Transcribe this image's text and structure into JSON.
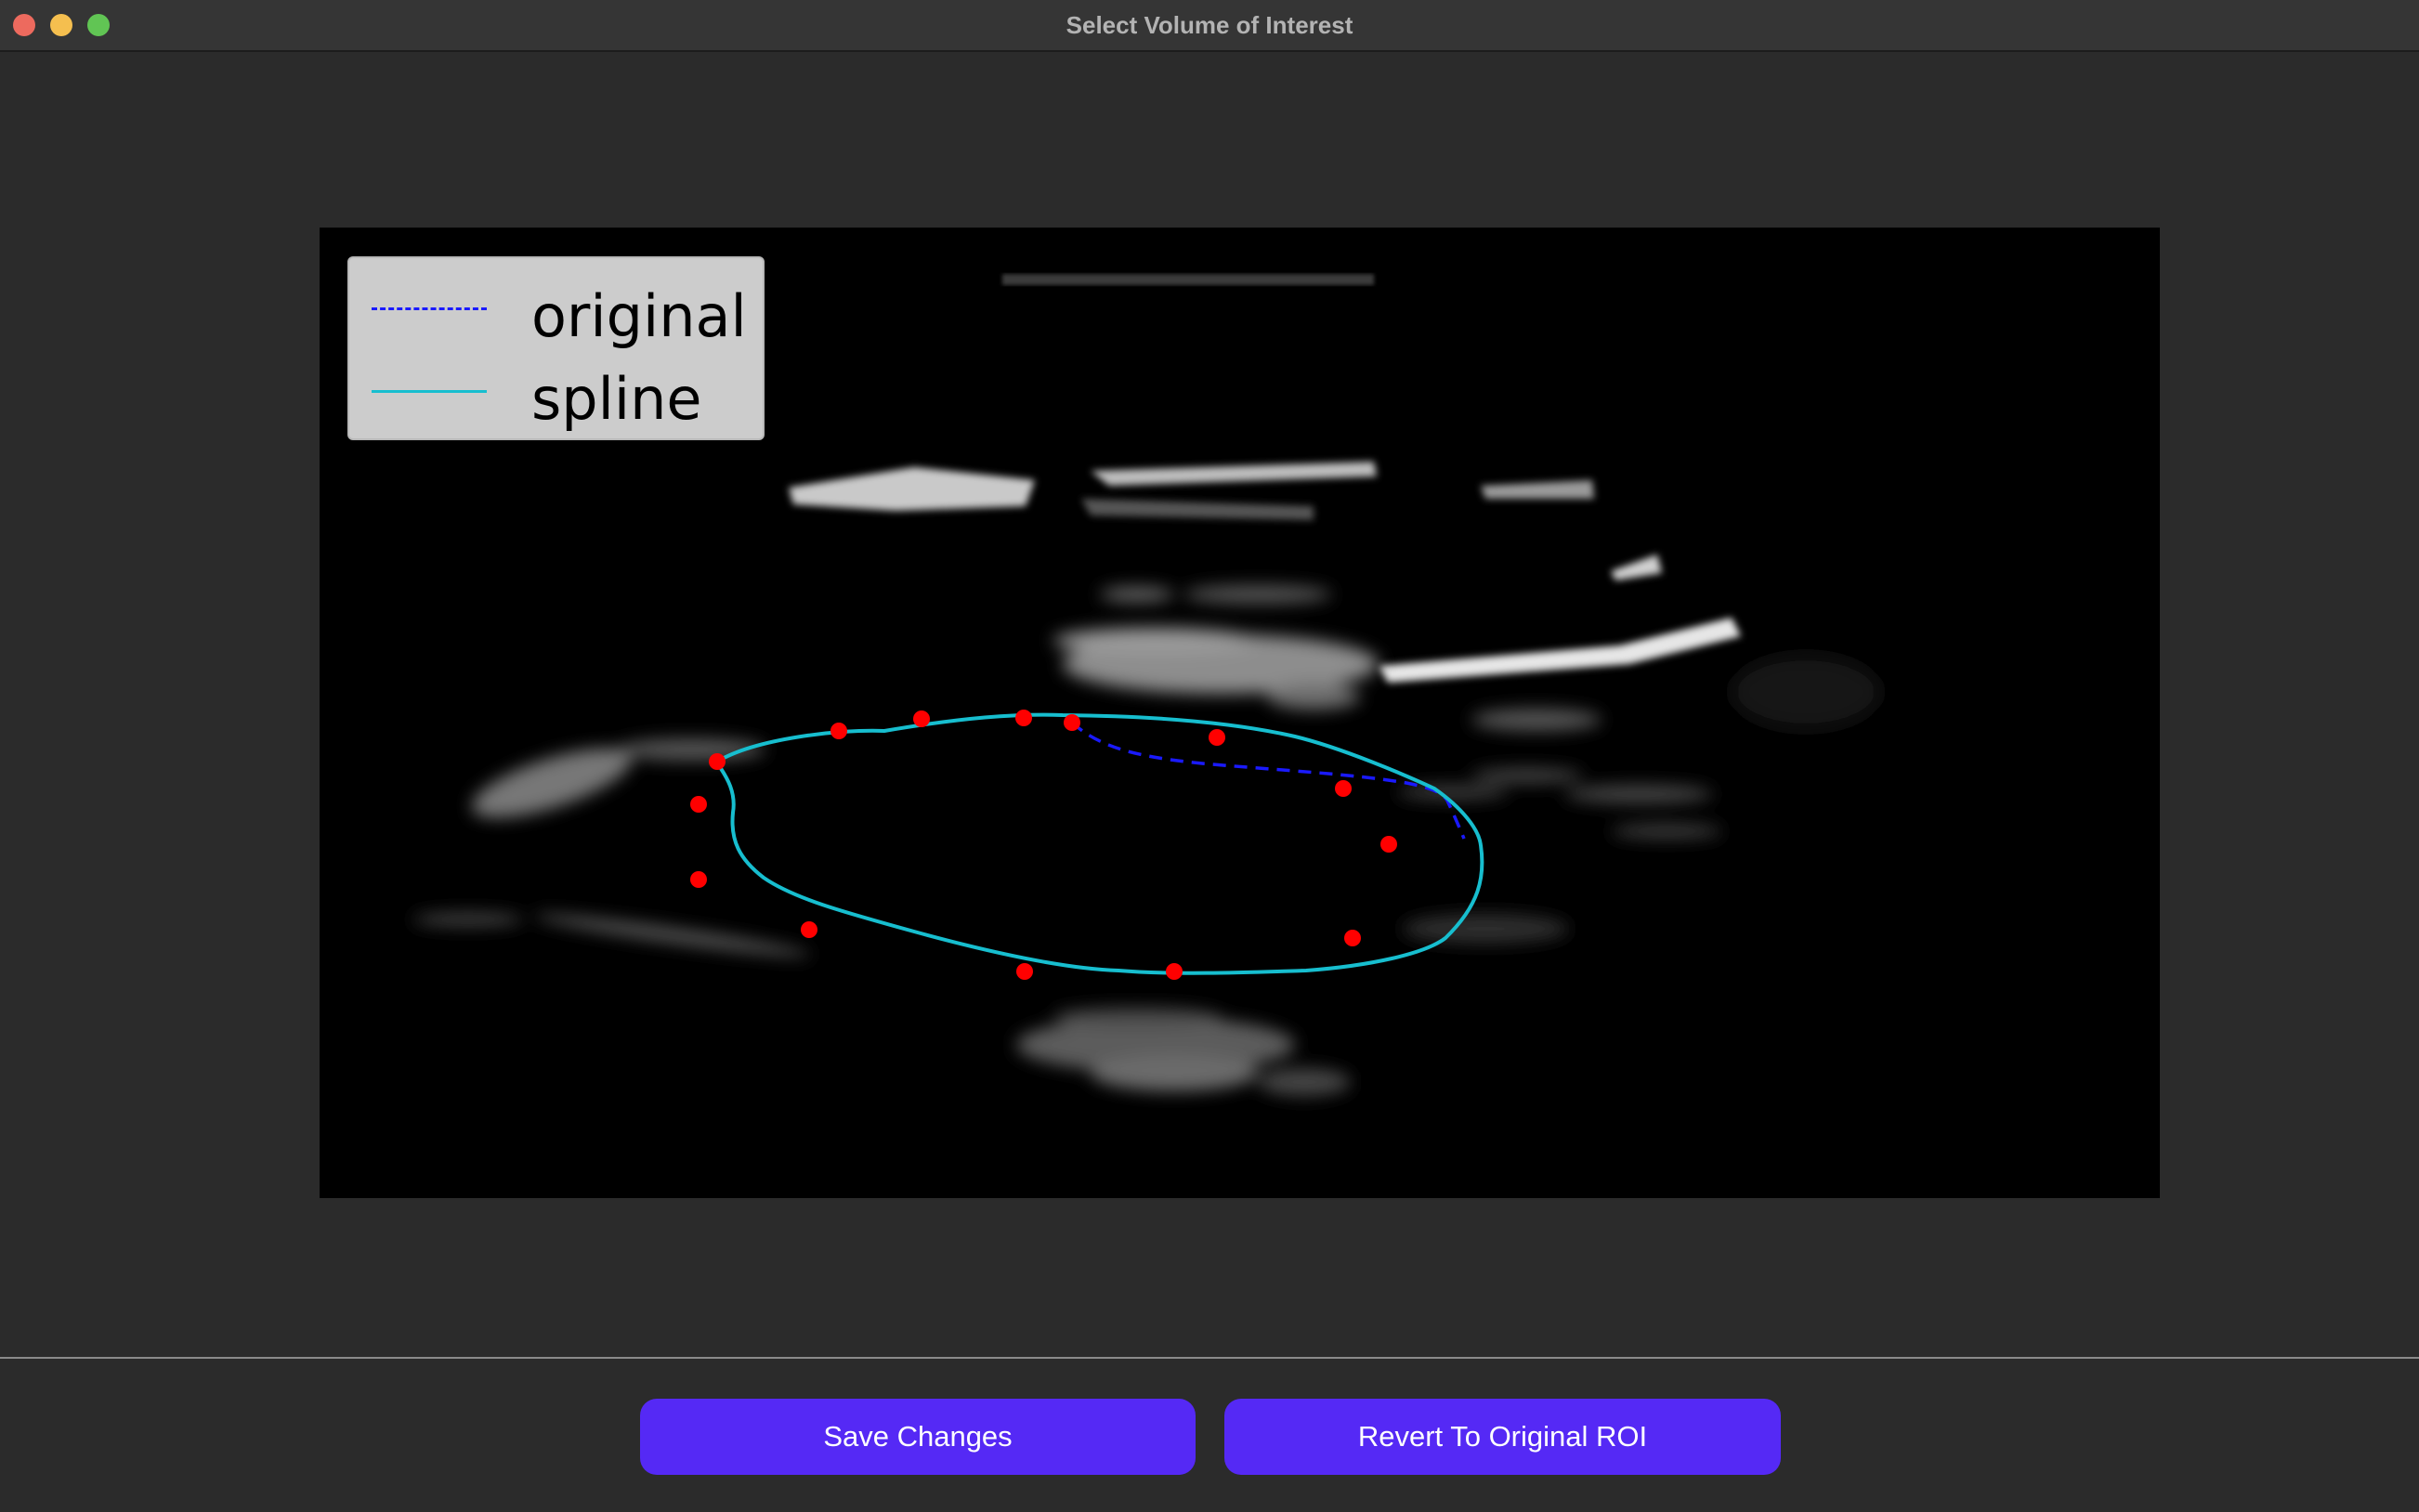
{
  "window": {
    "title": "Select Volume of Interest"
  },
  "legend": {
    "items": [
      {
        "label": "original",
        "style": "dashed",
        "color": "#1a1aff"
      },
      {
        "label": "spline",
        "style": "solid",
        "color": "#17becf"
      }
    ]
  },
  "overlay": {
    "control_point_color": "#ff0000",
    "spline_color": "#17becf",
    "original_color": "#1a1aff"
  },
  "buttons": {
    "save_label": "Save Changes",
    "revert_label": "Revert To Original ROI"
  },
  "colors": {
    "accent": "#5529f5",
    "background": "#2b2b2b"
  }
}
